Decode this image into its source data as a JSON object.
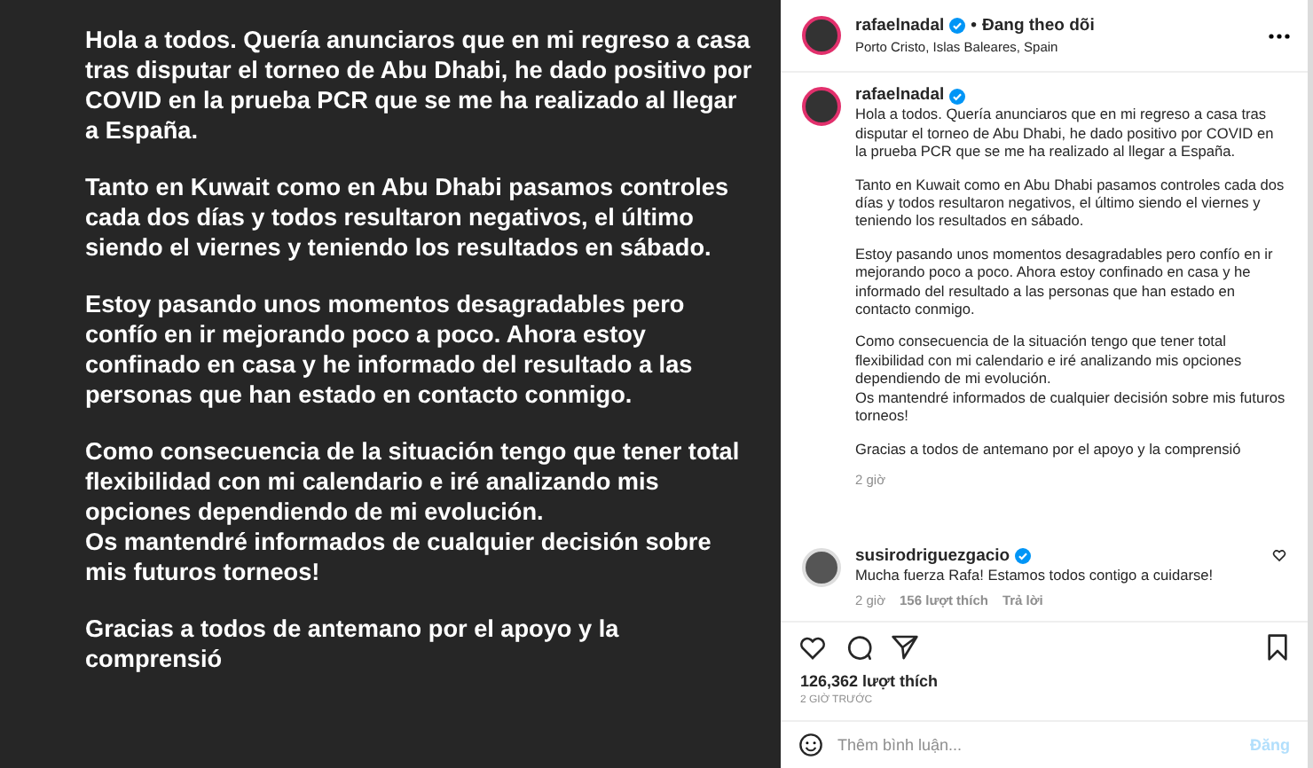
{
  "post_image": {
    "paragraphs": [
      "Hola a todos. Quería anunciaros que en mi regreso a casa tras disputar el torneo de Abu Dhabi, he dado positivo por COVID en la prueba PCR que se me ha realizado al llegar a España.",
      "Tanto en Kuwait como en Abu Dhabi pasamos controles cada dos días y todos resultaron negativos, el último siendo el viernes y teniendo los resultados en sábado.",
      "Estoy pasando unos momentos desagradables pero confío en ir mejorando poco a poco. Ahora estoy confinado en casa y he informado del resultado a las personas que han estado en contacto conmigo.",
      "Como consecuencia de la situación tengo que tener total flexibilidad con mi calendario e iré analizando mis opciones dependiendo de mi evolución.\nOs mantendré informados de cualquier decisión sobre mis futuros torneos!",
      "Gracias a todos de antemano por el apoyo y la comprensió"
    ]
  },
  "header": {
    "username": "rafaelnadal",
    "verified": true,
    "separator": "•",
    "follow_status": "Đang theo dõi",
    "location": "Porto Cristo, Islas Baleares, Spain"
  },
  "caption": {
    "username": "rafaelnadal",
    "verified": true,
    "paragraphs": [
      "Hola a todos. Quería anunciaros que en mi regreso a casa tras disputar el torneo de Abu Dhabi, he dado positivo por COVID en la prueba PCR que se me ha realizado al llegar a España.",
      "Tanto en Kuwait como en Abu Dhabi pasamos controles cada dos días y todos resultaron negativos, el último siendo el viernes y teniendo los resultados en sábado.",
      "Estoy pasando unos momentos desagradables pero confío en ir mejorando poco a poco. Ahora estoy confinado en casa y he informado del resultado a las personas que han estado en contacto conmigo.",
      "Como consecuencia de la situación tengo que tener total flexibilidad con mi calendario e iré analizando mis opciones dependiendo de mi evolución.\nOs mantendré informados de cualquier decisión sobre mis futuros torneos!",
      "Gracias a todos de antemano por el apoyo y la comprensió"
    ],
    "time": "2 giờ"
  },
  "comments": [
    {
      "username": "susirodriguezgacio",
      "verified": true,
      "text": "Mucha fuerza Rafa! Estamos todos contigo a cuidarse!",
      "time": "2 giờ",
      "likes": "156 lượt thích",
      "reply": "Trả lời"
    }
  ],
  "likes": "126,362 lượt thích",
  "posted": "2 GIỜ TRƯỚC",
  "comment_box": {
    "placeholder": "Thêm bình luận...",
    "post_button": "Đăng"
  }
}
